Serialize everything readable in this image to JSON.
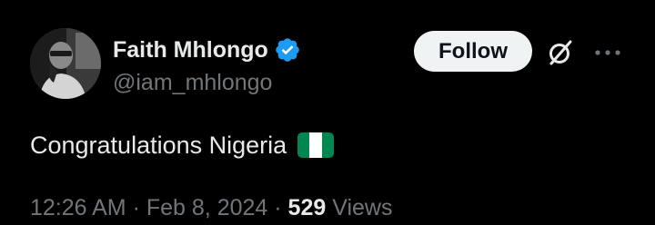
{
  "author": {
    "display_name": "Faith Mhlongo",
    "handle": "@iam_mhlongo",
    "verified": true,
    "verified_color": "#1d9bf0"
  },
  "actions": {
    "follow_label": "Follow",
    "grok_icon": "grok-icon",
    "more_icon": "more-icon"
  },
  "tweet": {
    "text": "Congratulations Nigeria",
    "emoji": "nigeria-flag",
    "flag_colors": [
      "#008751",
      "#ffffff",
      "#008751"
    ]
  },
  "meta": {
    "time": "12:26 AM",
    "separator": "·",
    "date": "Feb 8, 2024",
    "views_count": "529",
    "views_label": "Views"
  },
  "colors": {
    "background": "#000000",
    "primary_text": "#e7e9ea",
    "secondary_text": "#71767b",
    "button_bg": "#eff3f4",
    "button_text": "#0f1419"
  }
}
